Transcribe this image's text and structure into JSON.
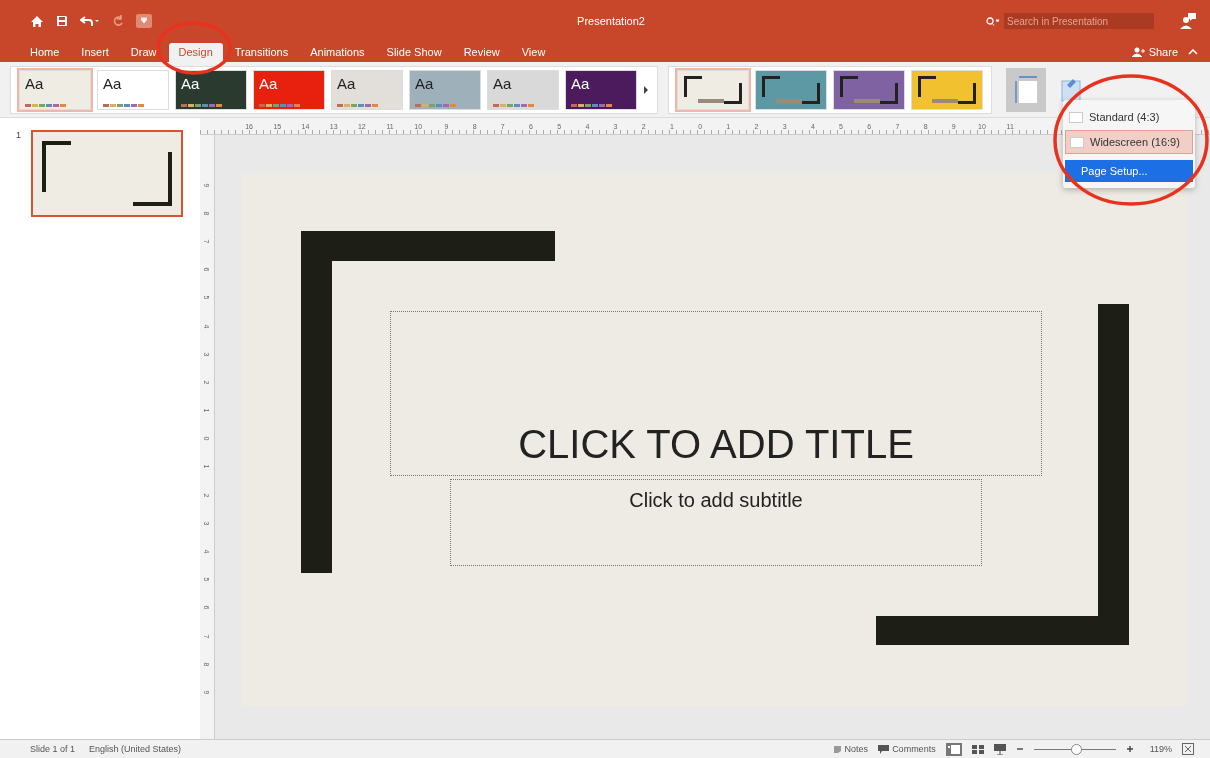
{
  "window": {
    "title": "Presentation2"
  },
  "search": {
    "placeholder": "Search in Presentation"
  },
  "share": {
    "label": "Share"
  },
  "tabs": [
    {
      "label": "Home",
      "selected": false
    },
    {
      "label": "Insert",
      "selected": false
    },
    {
      "label": "Draw",
      "selected": false
    },
    {
      "label": "Design",
      "selected": true
    },
    {
      "label": "Transitions",
      "selected": false
    },
    {
      "label": "Animations",
      "selected": false
    },
    {
      "label": "Slide Show",
      "selected": false
    },
    {
      "label": "Review",
      "selected": false
    },
    {
      "label": "View",
      "selected": false
    }
  ],
  "themes": [
    {
      "label": "Aa",
      "selected": true,
      "color": "#efece4"
    },
    {
      "label": "Aa",
      "selected": false,
      "color": "#ffffff"
    },
    {
      "label": "Aa",
      "selected": false,
      "color": "#2b3a2f"
    },
    {
      "label": "Aa",
      "selected": false,
      "color": "#e8200e"
    },
    {
      "label": "Aa",
      "selected": false,
      "color": "#e2dfda"
    },
    {
      "label": "Aa",
      "selected": false,
      "color": "#9eb1bb"
    },
    {
      "label": "Aa",
      "selected": false,
      "color": "#d9d9d9"
    },
    {
      "label": "Aa",
      "selected": false,
      "color": "#4b1b5e"
    }
  ],
  "variants": [
    {
      "selected": true,
      "color": "#efece4"
    },
    {
      "selected": false,
      "color": "#5d98a5"
    },
    {
      "selected": false,
      "color": "#7e62a1"
    },
    {
      "selected": false,
      "color": "#f2c12f"
    }
  ],
  "size_menu": {
    "items": [
      {
        "kind": "option",
        "label": "Standard (4:3)",
        "selected": false
      },
      {
        "kind": "option",
        "label": "Widescreen (16:9)",
        "selected": true
      },
      {
        "kind": "command",
        "label": "Page Setup...",
        "selected": true
      }
    ]
  },
  "ruler": {
    "horizontal": [
      "16",
      "15",
      "14",
      "13",
      "12",
      "11",
      "10",
      "9",
      "8",
      "7",
      "6",
      "5",
      "4",
      "3",
      "2",
      "1",
      "0",
      "1",
      "2",
      "3",
      "4",
      "5",
      "6",
      "7",
      "8",
      "9",
      "10",
      "11"
    ],
    "vertical": [
      "9",
      "8",
      "7",
      "6",
      "5",
      "4",
      "3",
      "2",
      "1",
      "0",
      "1",
      "2",
      "3",
      "4",
      "5",
      "6",
      "7",
      "8",
      "9"
    ]
  },
  "slides": [
    {
      "number": "1",
      "selected": true
    }
  ],
  "slide": {
    "title_placeholder": "CLICK TO ADD TITLE",
    "subtitle_placeholder": "Click to add subtitle"
  },
  "status_bar": {
    "slide": "Slide 1 of 1",
    "language": "English (United States)",
    "notes": "Notes",
    "comments": "Comments",
    "zoom": {
      "level": 0.52
    },
    "zoom_text": "119%"
  }
}
